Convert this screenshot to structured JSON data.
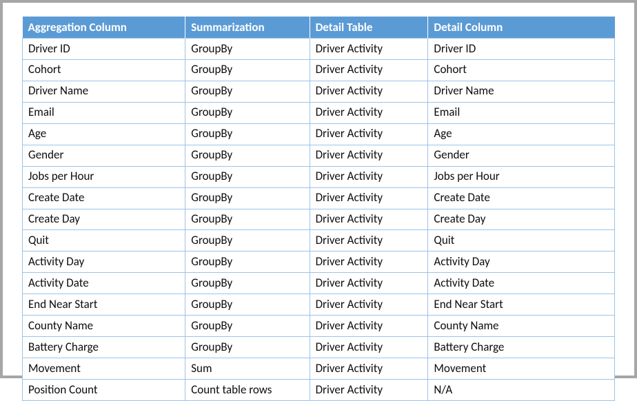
{
  "table": {
    "columns": [
      "Aggregation Column",
      "Summarization",
      "Detail Table",
      "Detail Column"
    ],
    "rows": [
      [
        "Driver ID",
        "GroupBy",
        "Driver Activity",
        "Driver ID"
      ],
      [
        "Cohort",
        "GroupBy",
        "Driver Activity",
        "Cohort"
      ],
      [
        "Driver Name",
        "GroupBy",
        "Driver Activity",
        "Driver Name"
      ],
      [
        "Email",
        "GroupBy",
        "Driver Activity",
        "Email"
      ],
      [
        "Age",
        "GroupBy",
        "Driver Activity",
        "Age"
      ],
      [
        "Gender",
        "GroupBy",
        "Driver Activity",
        "Gender"
      ],
      [
        "Jobs per Hour",
        "GroupBy",
        "Driver Activity",
        "Jobs per Hour"
      ],
      [
        "Create Date",
        "GroupBy",
        "Driver Activity",
        "Create Date"
      ],
      [
        "Create Day",
        "GroupBy",
        "Driver Activity",
        "Create Day"
      ],
      [
        "Quit",
        "GroupBy",
        "Driver Activity",
        "Quit"
      ],
      [
        "Activity Day",
        "GroupBy",
        "Driver Activity",
        "Activity Day"
      ],
      [
        "Activity Date",
        "GroupBy",
        "Driver Activity",
        "Activity Date"
      ],
      [
        "End Near Start",
        "GroupBy",
        "Driver Activity",
        "End Near Start"
      ],
      [
        "County Name",
        "GroupBy",
        "Driver Activity",
        "County Name"
      ],
      [
        "Battery Charge",
        "GroupBy",
        "Driver Activity",
        "Battery Charge"
      ],
      [
        "Movement",
        "Sum",
        "Driver Activity",
        "Movement"
      ],
      [
        "Position Count",
        "Count table rows",
        "Driver Activity",
        "N/A"
      ]
    ]
  }
}
